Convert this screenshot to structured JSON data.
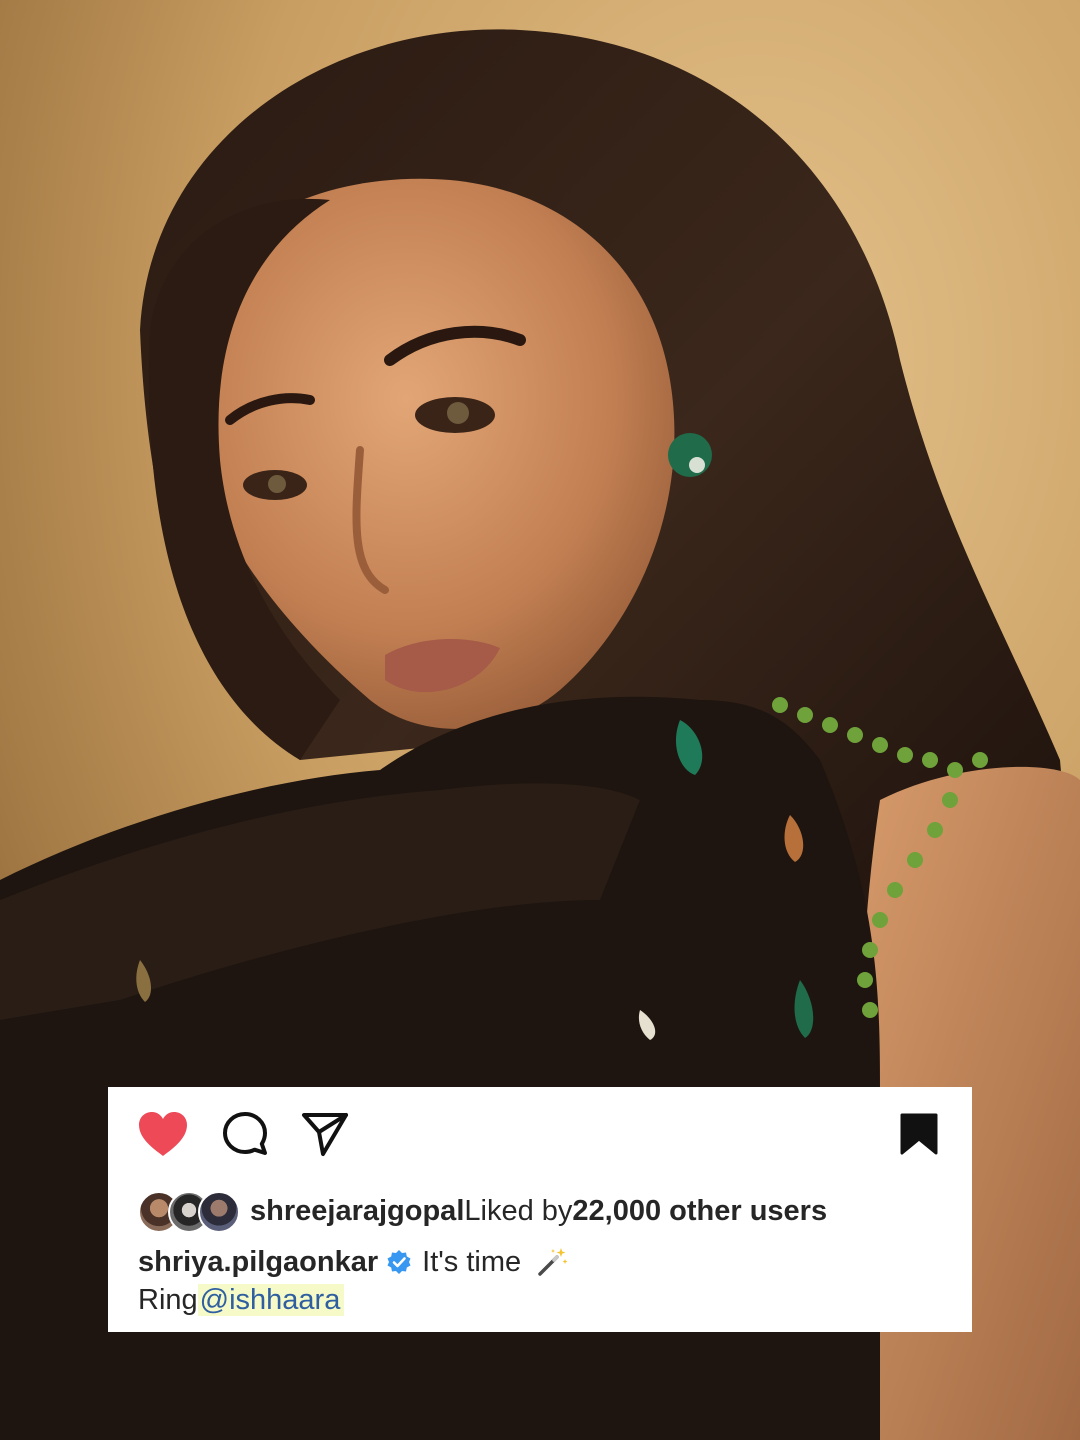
{
  "post": {
    "actions": {
      "like_icon": "heart-filled-icon",
      "comment_icon": "comment-bubble-icon",
      "share_icon": "paper-plane-icon",
      "save_icon": "bookmark-filled-icon",
      "like_color": "#ed4956"
    },
    "likes": {
      "liked_user": "shreejarajgopal",
      "liked_prefix": "Liked by ",
      "liked_count": "22,000 other users"
    },
    "caption": {
      "username": "shriya.pilgaonkar",
      "text": "It's time",
      "emoji_icon": "magic-wand-icon",
      "line2_prefix": "Ring",
      "mention": "@ishhaara"
    }
  }
}
